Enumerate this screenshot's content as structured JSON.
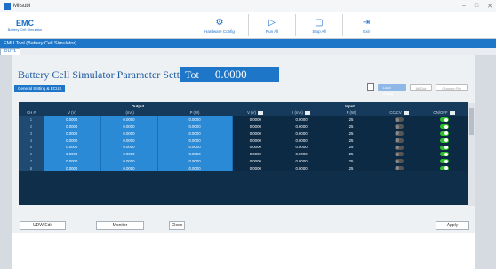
{
  "window": {
    "title": "Mitsubi"
  },
  "toolbar": {
    "logo_mark": "EMC",
    "logo_sub": "Battery Cell Simulator",
    "buttons": [
      {
        "label": "Hardware Config",
        "icon": "hardware-config-icon"
      },
      {
        "label": "Run All",
        "icon": "play-icon"
      },
      {
        "label": "Stop All",
        "icon": "stop-icon"
      },
      {
        "label": "Exit",
        "icon": "exit-icon"
      }
    ]
  },
  "app_bar": {
    "title": "EMU Tool (Battery Cell Simulator)"
  },
  "tabs": [
    {
      "label": "DUT1"
    }
  ],
  "panel": {
    "title": "Battery Cell Simulator Parameter Setting",
    "tot_label": "Tot",
    "tot_value": "0.0000",
    "subtab": "General Setting & ECUS",
    "right_pill1": "Load Config",
    "right_pill2": "All Dut",
    "right_pill3": "Change File"
  },
  "table": {
    "groups": {
      "output": "Output",
      "input": "Input"
    },
    "columns": [
      "CH #",
      "V (V)",
      "I (mA)",
      "P (W)",
      "V (V)",
      "I (mA)",
      "P (W)",
      "CC/CV",
      "ON/OFF"
    ],
    "rows": [
      {
        "ch": "1",
        "out_v": "0.0000",
        "out_i": "0.0000",
        "out_p": "0.0000",
        "in_v": "0.0000",
        "in_i": "0.0000",
        "in_p": "25",
        "state": "on"
      },
      {
        "ch": "2",
        "out_v": "0.0000",
        "out_i": "0.0000",
        "out_p": "0.0000",
        "in_v": "0.0000",
        "in_i": "0.0000",
        "in_p": "25",
        "state": "on"
      },
      {
        "ch": "3",
        "out_v": "0.0000",
        "out_i": "0.0000",
        "out_p": "0.0000",
        "in_v": "0.0000",
        "in_i": "0.0000",
        "in_p": "25",
        "state": "on"
      },
      {
        "ch": "4",
        "out_v": "0.0000",
        "out_i": "0.0000",
        "out_p": "0.0000",
        "in_v": "0.0000",
        "in_i": "0.0000",
        "in_p": "25",
        "state": "on"
      },
      {
        "ch": "5",
        "out_v": "0.0000",
        "out_i": "0.0000",
        "out_p": "0.0000",
        "in_v": "0.0000",
        "in_i": "0.0000",
        "in_p": "25",
        "state": "on"
      },
      {
        "ch": "6",
        "out_v": "0.0000",
        "out_i": "0.0000",
        "out_p": "0.0000",
        "in_v": "0.0000",
        "in_i": "0.0000",
        "in_p": "25",
        "state": "on"
      },
      {
        "ch": "7",
        "out_v": "0.0000",
        "out_i": "0.0000",
        "out_p": "0.0000",
        "in_v": "0.0000",
        "in_i": "0.0000",
        "in_p": "25",
        "state": "on"
      },
      {
        "ch": "8",
        "out_v": "0.0000",
        "out_i": "0.0000",
        "out_p": "0.0000",
        "in_v": "0.0000",
        "in_i": "0.0000",
        "in_p": "25",
        "state": "on"
      }
    ]
  },
  "bottom": {
    "buttons": [
      {
        "label": "UDW Edit"
      },
      {
        "label": "Monitor"
      },
      {
        "label": "Close"
      },
      {
        "label": "Apply"
      }
    ]
  },
  "colors": {
    "accent": "#1e76c9",
    "table_bg": "#0f2e4a",
    "output_cell": "#2b8ad6",
    "toggle_on": "#2fc12c"
  }
}
